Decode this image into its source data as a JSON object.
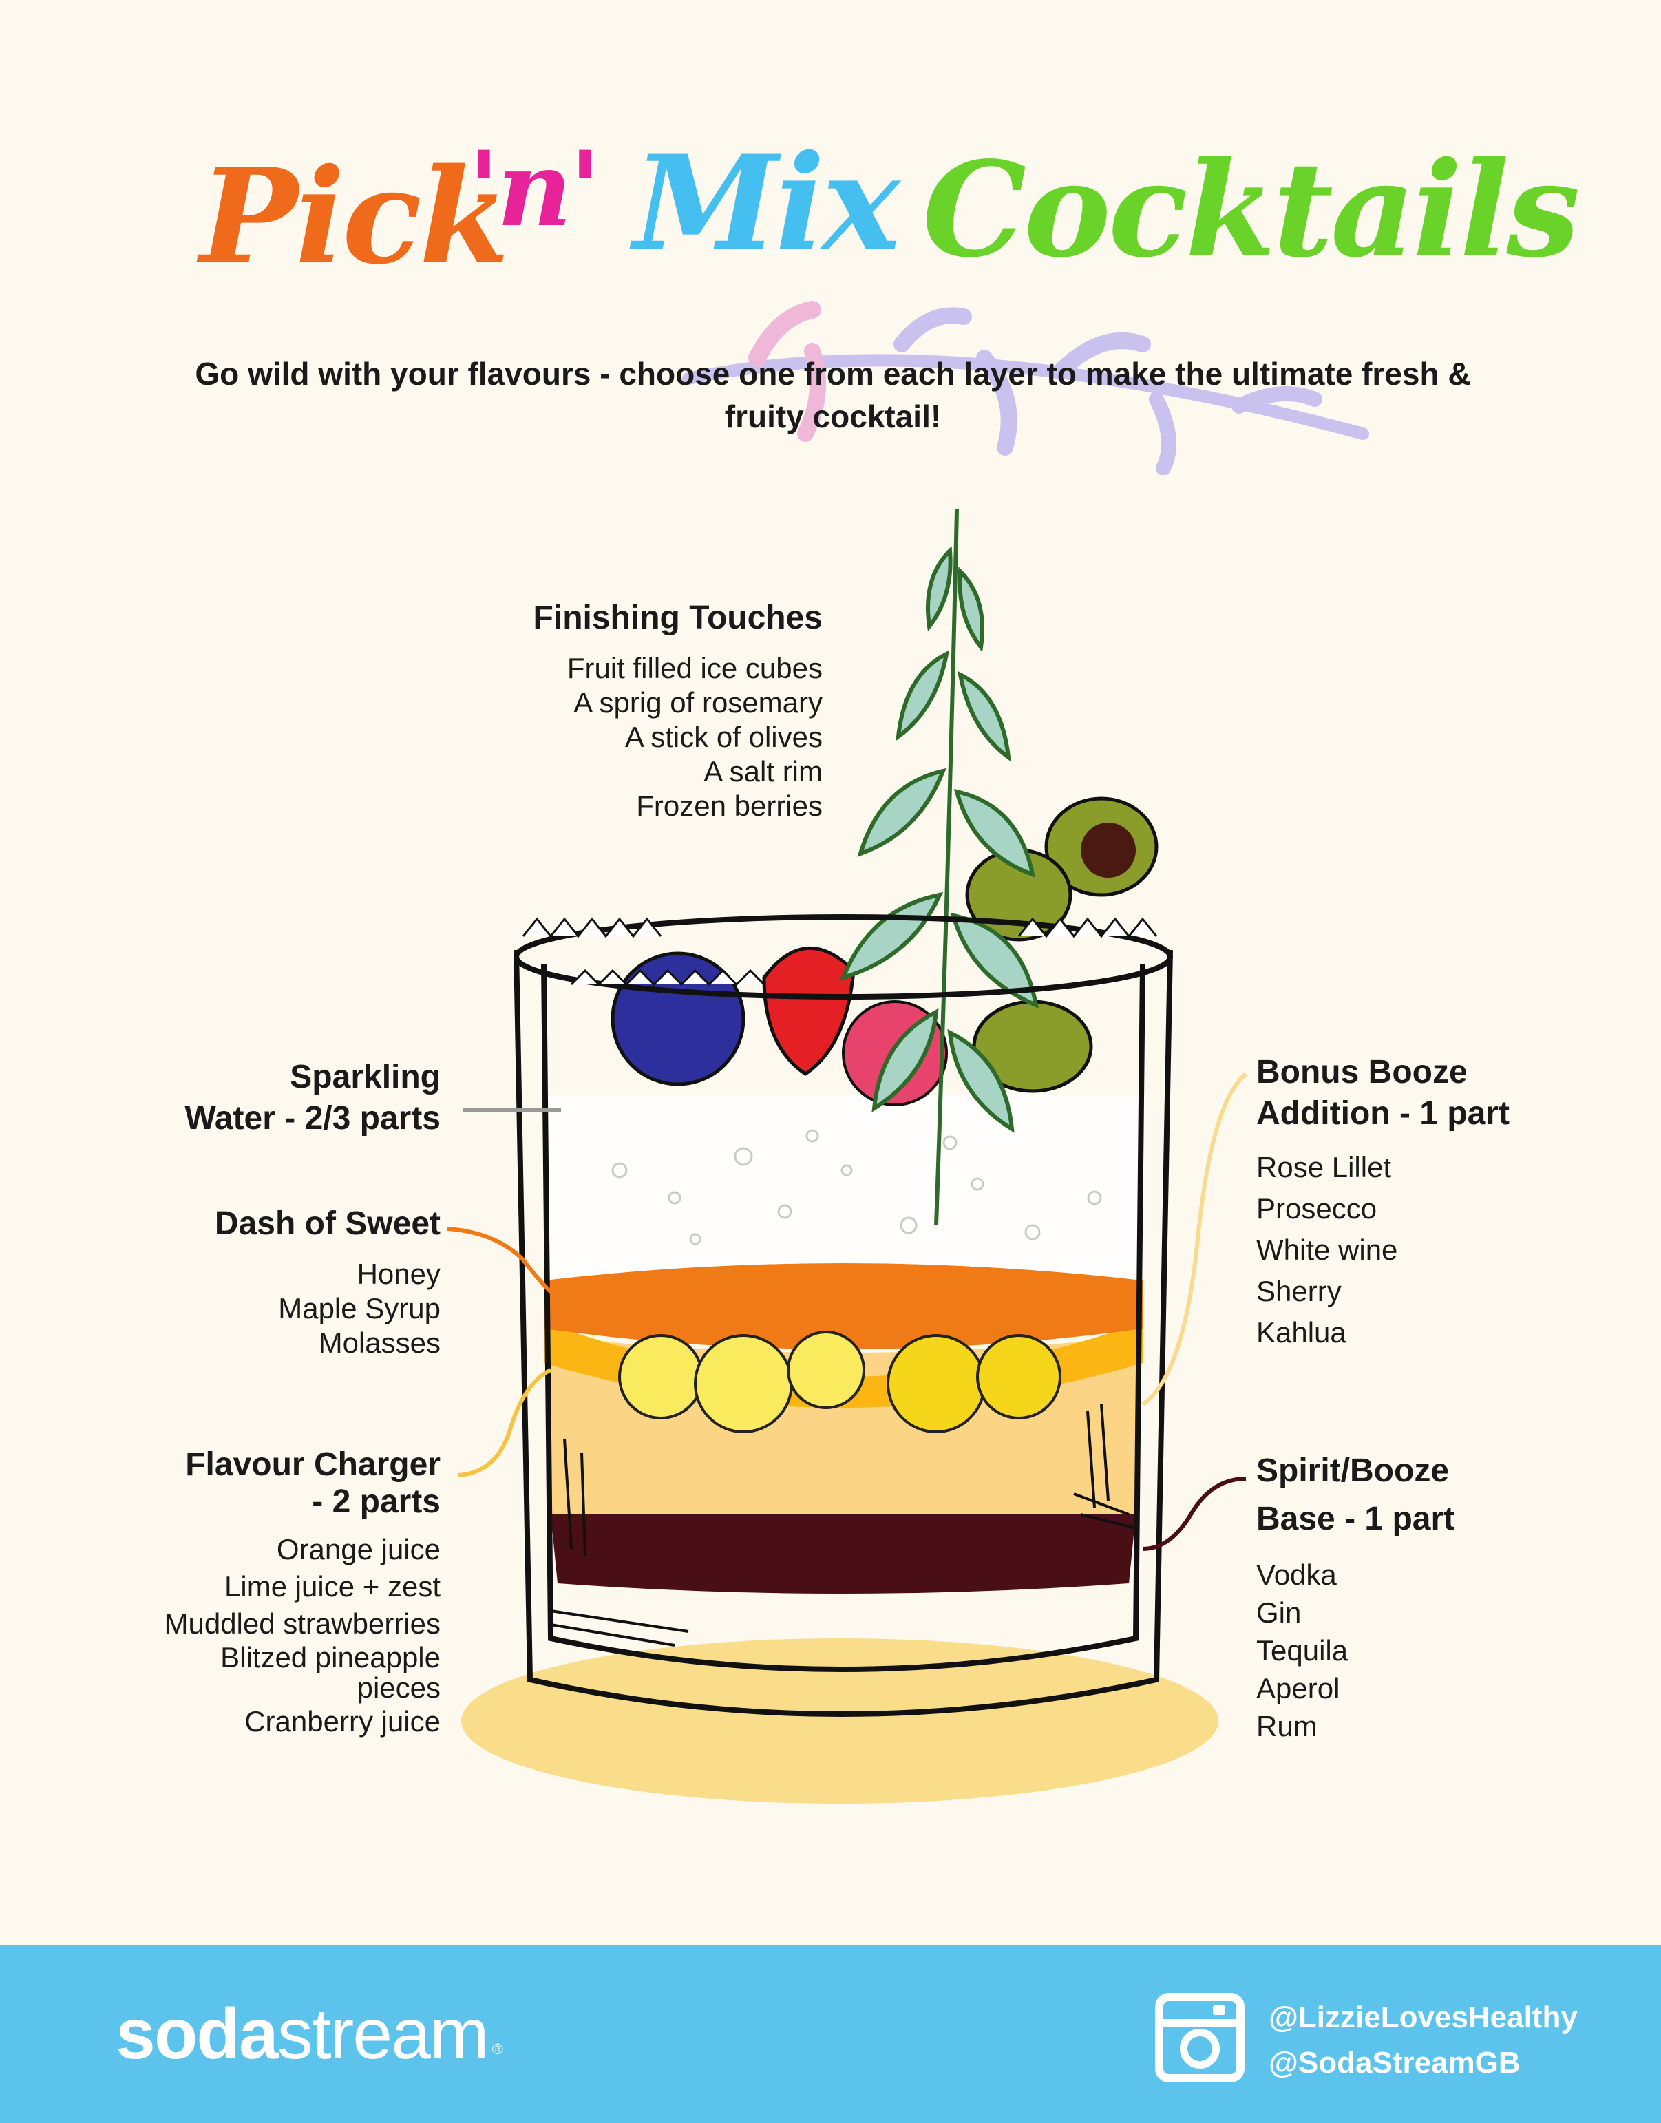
{
  "title": {
    "part1": "Pick",
    "part2": "'n'",
    "part3": "Mix",
    "part4": "Cocktails",
    "colors": [
      "#f06a1c",
      "#e8239a",
      "#44bff0",
      "#6ad32a"
    ]
  },
  "subtitle": "Go wild with your flavours - choose one from each layer to make the ultimate fresh & fruity cocktail!",
  "finishing": {
    "heading": "Finishing Touches",
    "items": [
      "Fruit filled ice cubes",
      "A sprig of rosemary",
      "A stick of olives",
      "A salt rim",
      "Frozen berries"
    ]
  },
  "sparkling": {
    "heading_line1": "Sparkling",
    "heading_line2": "Water - 2/3 parts"
  },
  "sweet": {
    "heading": "Dash of Sweet",
    "items": [
      "Honey",
      "Maple Syrup",
      "Molasses"
    ]
  },
  "charger": {
    "heading_line1": "Flavour Charger",
    "heading_line2": "- 2 parts",
    "items": [
      "Orange juice",
      "Lime juice + zest",
      "Muddled strawberries",
      "Blitzed pineapple",
      "pieces",
      "Cranberry juice"
    ]
  },
  "bonus": {
    "heading_line1": "Bonus Booze",
    "heading_line2": "Addition - 1 part",
    "items": [
      "Rose Lillet",
      "Prosecco",
      "White wine",
      "Sherry",
      "Kahlua"
    ]
  },
  "spirit": {
    "heading_line1": "Spirit/Booze",
    "heading_line2": "Base - 1 part",
    "items": [
      "Vodka",
      "Gin",
      "Tequila",
      "Aperol",
      "Rum"
    ]
  },
  "footer": {
    "brand_bold": "soda",
    "brand_light": "stream",
    "brand_mark": "®",
    "handle1": "@LizzieLovesHealthy",
    "handle2": "@SodaStreamGB",
    "background": "#5bc3ec"
  },
  "icons": [
    "instagram-icon",
    "rosemary-sprig-icon",
    "cocktail-glass-illustration"
  ]
}
